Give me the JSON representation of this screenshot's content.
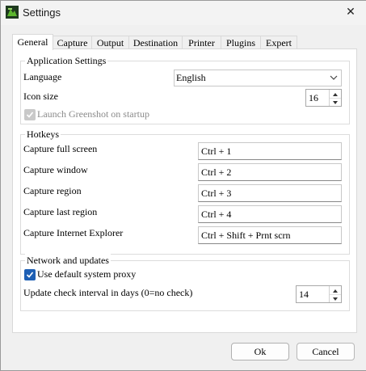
{
  "window": {
    "title": "Settings",
    "close_symbol": "✕"
  },
  "tabs": [
    {
      "label": "General"
    },
    {
      "label": "Capture"
    },
    {
      "label": "Output"
    },
    {
      "label": "Destination"
    },
    {
      "label": "Printer"
    },
    {
      "label": "Plugins"
    },
    {
      "label": "Expert"
    }
  ],
  "app_settings": {
    "legend": "Application Settings",
    "language_label": "Language",
    "language_value": "English",
    "icon_size_label": "Icon size",
    "icon_size_value": "16",
    "launch_label": "Launch Greenshot on startup",
    "launch_checked": true
  },
  "hotkeys": {
    "legend": "Hotkeys",
    "items": [
      {
        "label": "Capture full screen",
        "value": "Ctrl + 1"
      },
      {
        "label": "Capture window",
        "value": "Ctrl + 2"
      },
      {
        "label": "Capture region",
        "value": "Ctrl + 3"
      },
      {
        "label": "Capture last region",
        "value": "Ctrl + 4"
      },
      {
        "label": "Capture Internet Explorer",
        "value": "Ctrl + Shift + Prnt scrn"
      }
    ]
  },
  "network": {
    "legend": "Network and updates",
    "proxy_label": "Use default system proxy",
    "proxy_checked": true,
    "interval_label": "Update check interval in days (0=no check)",
    "interval_value": "14"
  },
  "buttons": {
    "ok": "Ok",
    "cancel": "Cancel"
  },
  "colors": {
    "accent": "#1d5fb4",
    "disabled": "#8a8a8a"
  },
  "icons": {
    "app": "greenshot-app-icon",
    "close": "close-icon",
    "dropdown": "chevron-down-icon",
    "spin_up": "arrow-up-icon",
    "spin_down": "arrow-down-icon",
    "check": "checkmark-icon"
  }
}
